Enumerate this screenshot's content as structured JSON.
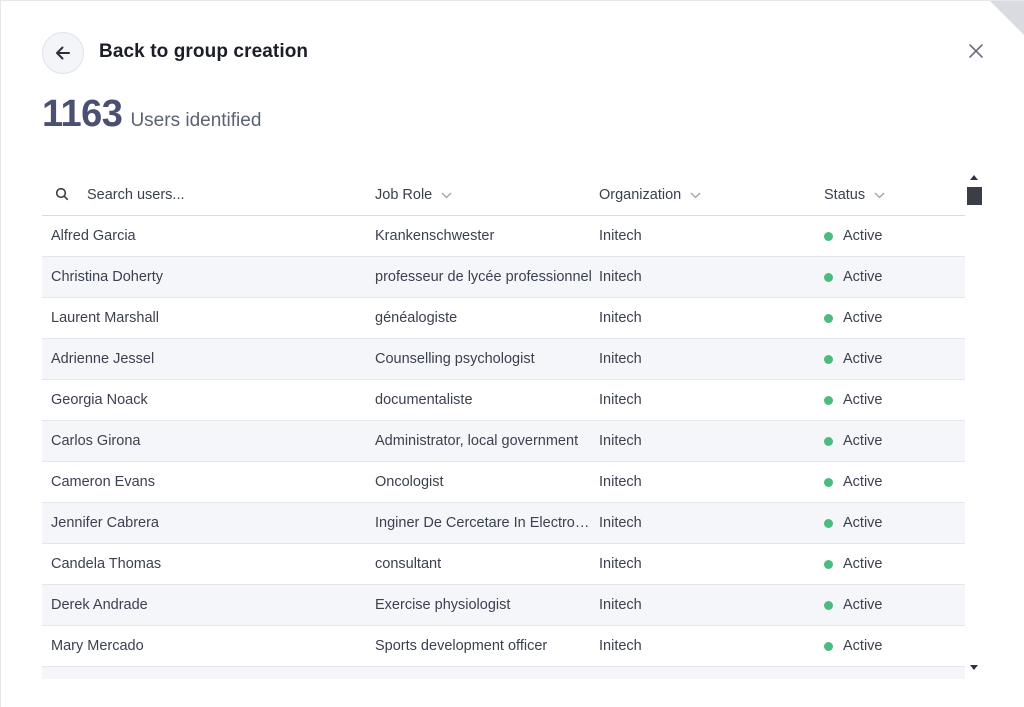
{
  "header": {
    "back_title": "Back to group creation"
  },
  "summary": {
    "count": "1163",
    "label": "Users identified"
  },
  "table": {
    "search_placeholder": "Search users...",
    "columns": [
      "Job Role",
      "Organization",
      "Status"
    ],
    "rows": [
      {
        "name": "Alfred Garcia",
        "role": "Krankenschwester",
        "org": "Initech",
        "status": "Active"
      },
      {
        "name": "Christina Doherty",
        "role": "professeur de lycée professionnel",
        "org": "Initech",
        "status": "Active"
      },
      {
        "name": "Laurent Marshall",
        "role": "généalogiste",
        "org": "Initech",
        "status": "Active"
      },
      {
        "name": "Adrienne Jessel",
        "role": "Counselling psychologist",
        "org": "Initech",
        "status": "Active"
      },
      {
        "name": "Georgia Noack",
        "role": "documentaliste",
        "org": "Initech",
        "status": "Active"
      },
      {
        "name": "Carlos Girona",
        "role": "Administrator, local government",
        "org": "Initech",
        "status": "Active"
      },
      {
        "name": "Cameron Evans",
        "role": "Oncologist",
        "org": "Initech",
        "status": "Active"
      },
      {
        "name": "Jennifer Cabrera",
        "role": "Inginer De Cercetare In Electrotehnica",
        "org": "Initech",
        "status": "Active"
      },
      {
        "name": "Candela Thomas",
        "role": "consultant",
        "org": "Initech",
        "status": "Active"
      },
      {
        "name": "Derek Andrade",
        "role": "Exercise physiologist",
        "org": "Initech",
        "status": "Active"
      },
      {
        "name": "Mary Mercado",
        "role": "Sports development officer",
        "org": "Initech",
        "status": "Active"
      }
    ]
  },
  "colors": {
    "status_active": "#4cbb7f",
    "count_text": "#4a5170"
  }
}
